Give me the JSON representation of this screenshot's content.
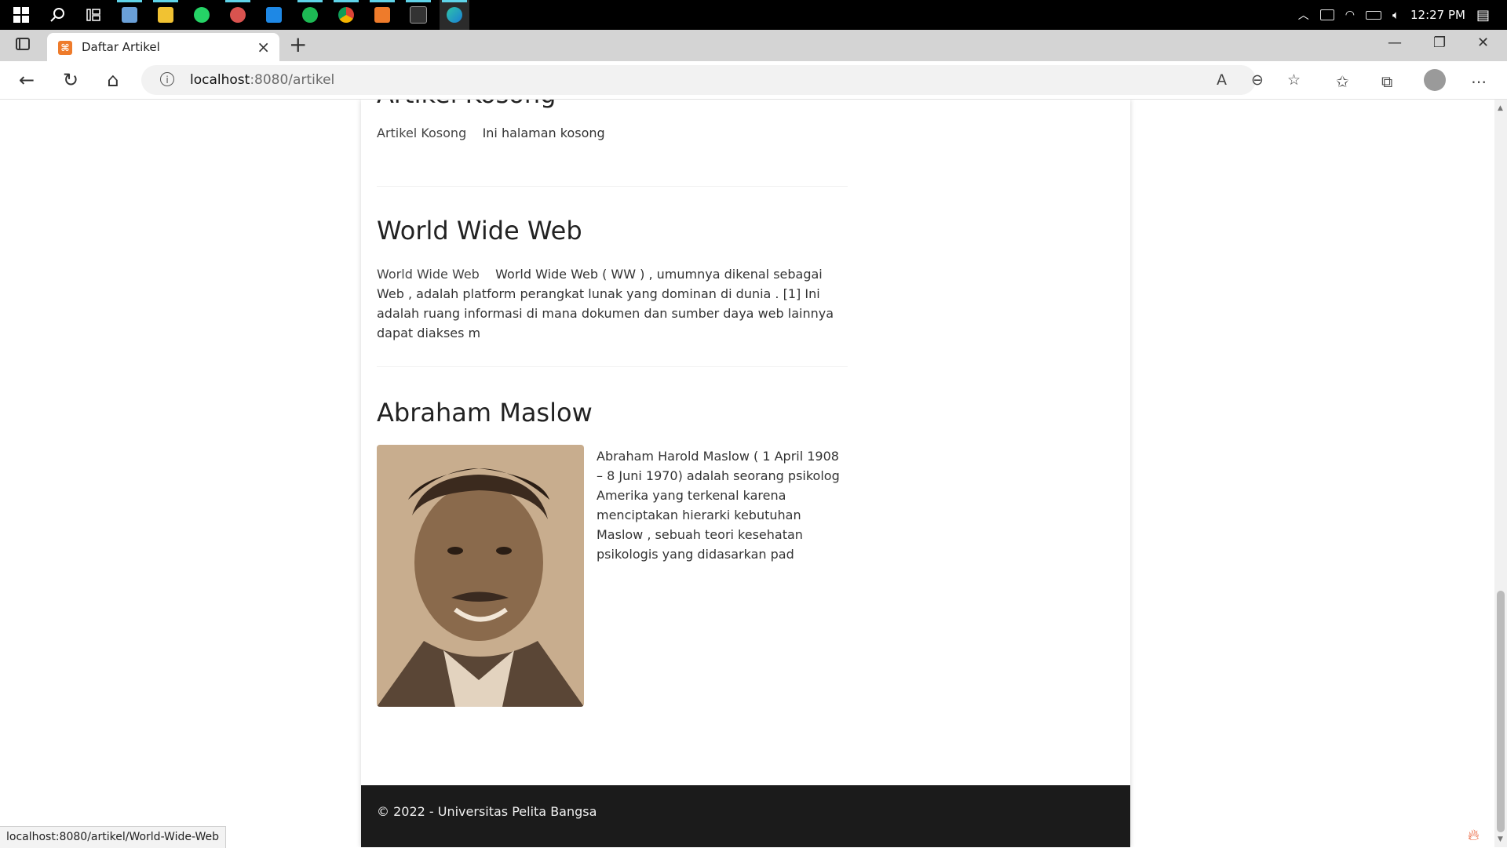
{
  "taskbar": {
    "icons": [
      "windows-start-icon",
      "search-icon",
      "task-view-icon",
      "photos-icon",
      "file-explorer-icon",
      "whatsapp-icon",
      "cloud-app-icon",
      "vscode-icon",
      "spotify-icon",
      "chrome-icon",
      "xampp-icon",
      "terminal-icon",
      "edge-icon"
    ],
    "clock": "12:27 PM",
    "colors": {
      "accent": "#5fd3e8"
    }
  },
  "browser": {
    "tab_title": "Daftar Artikel",
    "tab_favicon": "xampp-icon",
    "new_tab": "+",
    "close_tab": "×",
    "window": {
      "minimize": "—",
      "restore": "❐",
      "close": "✕"
    },
    "address": {
      "host": "localhost",
      "path": ":8080/artikel"
    },
    "status_url": "localhost:8080/artikel/World-Wide-Web"
  },
  "articles": [
    {
      "title": "Artikel Kosong",
      "img_alt": "Artikel Kosong",
      "body": "Ini halaman kosong"
    },
    {
      "title": "World Wide Web",
      "img_alt": "World Wide Web",
      "body": "World Wide Web ( WW ) , umumnya dikenal sebagai Web , adalah platform perangkat lunak yang dominan di dunia . [1] Ini adalah ruang informasi di mana dokumen dan sumber daya web lainnya dapat diakses m"
    },
    {
      "title": "Abraham Maslow",
      "img_alt": "Abraham Maslow",
      "body": "Abraham Harold Maslow ( 1 April 1908 – 8 Juni 1970) adalah seorang psikolog Amerika yang terkenal karena menciptakan hierarki kebutuhan Maslow , sebuah teori kesehatan psikologis yang didasarkan pad"
    }
  ],
  "footer": {
    "text": "© 2022 - Universitas Pelita Bangsa"
  }
}
